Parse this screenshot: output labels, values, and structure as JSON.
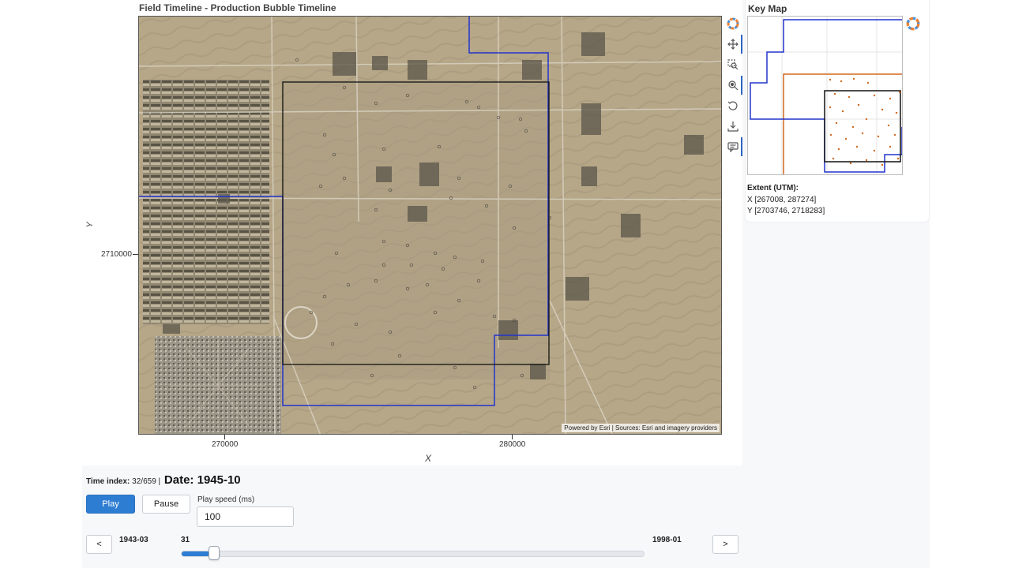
{
  "plot": {
    "title": "Field Timeline - Production Bubble Timeline",
    "x_axis_label": "X",
    "y_axis_label": "Y",
    "x_ticks": [
      "270000",
      "280000"
    ],
    "y_ticks": [
      "2710000"
    ],
    "attribution": "Powered by Esri | Sources: Esri and imagery providers"
  },
  "toolbar": {
    "logo": "bokeh-logo-icon",
    "tools": [
      "pan-icon",
      "box-zoom-icon",
      "wheel-zoom-icon",
      "reset-icon",
      "save-icon",
      "hover-icon"
    ]
  },
  "keymap": {
    "title": "Key Map",
    "extent_title": "Extent (UTM):",
    "extent_x": "X [267008, 287274]",
    "extent_y": "Y [2703746, 2718283]",
    "colors": {
      "boundary": "#2233cc",
      "outline": "#d2691e",
      "view": "#111111",
      "wells": "#d2691e"
    }
  },
  "controls": {
    "time_index_label": "Time index:",
    "time_index_value": "32/659 |",
    "date_label": "Date: 1945-10",
    "play_label": "Play",
    "pause_label": "Pause",
    "speed_label": "Play speed (ms)",
    "speed_value": "100",
    "prev_label": "<",
    "next_label": ">",
    "start_label": "1943-03",
    "current_label": "31",
    "end_label": "1998-01",
    "slider_fraction": 0.047,
    "accent_color": "#2d7dd2"
  }
}
